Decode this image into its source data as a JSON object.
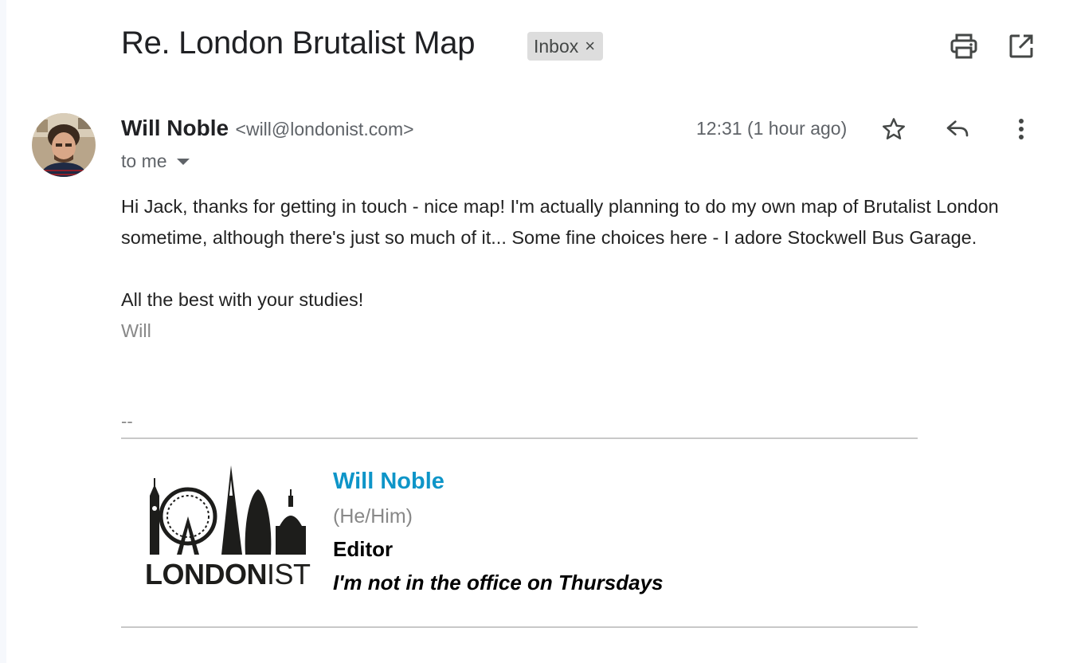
{
  "email": {
    "subject": "Re. London Brutalist Map",
    "label": "Inbox",
    "label_remove": "×",
    "sender_name": "Will Noble",
    "sender_email": "<will@londonist.com>",
    "recipient": "to me",
    "timestamp": "12:31 (1 hour ago)",
    "body": {
      "paragraph1": "Hi Jack, thanks for getting in touch - nice map! I'm actually planning to do my own map of Brutalist London sometime, although there's just so much of it... Some fine choices here - I adore Stockwell Bus Garage.",
      "paragraph2": "All the best with your studies!",
      "signoff": "Will"
    }
  },
  "signature": {
    "separator": "--",
    "logo_text_bold": "LONDON",
    "logo_text_light": "IST",
    "name": "Will Noble",
    "pronouns": "(He/Him)",
    "title": "Editor",
    "note": "I'm not in the office on Thursdays"
  },
  "icons": {
    "print": "print-icon",
    "open_new": "open-in-new-window-icon",
    "star": "star-icon",
    "reply": "reply-icon",
    "more": "more-vert-icon",
    "caret": "chevron-down-icon"
  },
  "colors": {
    "accent_link": "#0e95c8",
    "chip_bg": "#dddddd",
    "text_main": "#202124",
    "text_muted": "#5f6368"
  }
}
